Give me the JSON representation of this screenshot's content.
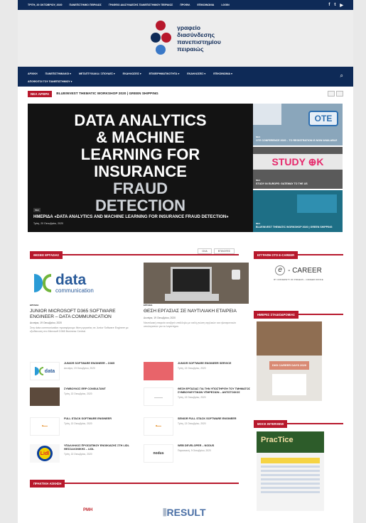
{
  "topbar": {
    "date": "ΤΡΙΤΗ, 20 ΟΚΤΩΒΡΙΟΥ, 2020",
    "links": [
      "ΠΑΝΕΠΙΣΤΗΜΙΟ ΠΕΙΡΑΙΩΣ",
      "ΓΡΑΦΕΙΟ ΔΙΑΣΥΝΔΕΣΗΣ ΠΑΝΕΠΙΣΤΗΜΙΟΥ ΠΕΙΡΑΙΩΣ",
      "ΠΡΟΦΙΛ",
      "ΕΠΙΚΟΙΝΩΝΙΑ",
      "LOGIN"
    ],
    "social": [
      "f",
      "t",
      "▶"
    ]
  },
  "logo": {
    "line1": "γραφείο",
    "line2": "διασύνδεσης",
    "line3": "πανεπιστημίου",
    "line4": "πειραιώς"
  },
  "nav": {
    "row1": [
      "ΑΡΧΙΚΗ",
      "ΠΑΝΕΠΙΣΤΗΜΙΑΚΟΙ ▾",
      "ΜΕΤΑΠΤΥΧΙΑΚΑ / ΣΠΟΥΔΕΣ ▾",
      "ΕΚΔΗΛΩΣΕΙΣ ▾",
      "ΕΠΙΧΕΙΡΗΜΑΤΙΚΟΤΗΤΑ ▾",
      "ΕΚΔΗΛΩΣΕΙΣ ▾",
      "ΕΠΙΚΟΙΝΩΝΙΑ ▾"
    ],
    "row2": [
      "ΑΠΟΦΟΙΤΟΙ ΤΟΥ ΠΑΝΕΠΙΣΤΗΜΙΟΥ ▾"
    ]
  },
  "ticker": {
    "badge": "ΝΕΑ ΑΡΘΡΑ",
    "text": "BLUEINVEST THEMATIC WORKSHOP 2020 | GREEN SHIPPING"
  },
  "hero": {
    "line1": "DATA ANALYTICS",
    "line2": "& MACHINE",
    "line3": "LEARNING FOR",
    "line4": "INSURANCE",
    "line5": "FRAUD",
    "line6": "DETECTION",
    "tag": "ΝΕΑ",
    "caption": "ΗΜΕΡΙΔΑ «DATA ANALYTICS AND MACHINE LEARNING FOR INSURANCE FRAUD DETECTION»",
    "meta": "Τρίτη, 20 Οκτωβρίου, 2020"
  },
  "tiles": [
    {
      "tag": "ΝΕΑ",
      "title": "OTE CONFERENCE 2020 – ΤΟ REGISTRATION IS NOW AVAILABLE",
      "logo": "OTE"
    },
    {
      "tag": "ΝΕΑ",
      "title": "STUDY IN EUROPE: GATEWAY TO THE US",
      "logo": "STUDY ⊕K"
    },
    {
      "tag": "ΝΕΑ",
      "title": "BLUEINVEST THEMATIC WORKSHOP 2020 | GREEN SHIPPING"
    }
  ],
  "jobs": {
    "heading": "ΘΕΣΕΙΣ ΕΡΓΑΣΙΑΣ",
    "tabs": [
      "ΟΛΑ",
      "ΕΠΙΛΟΓΕΣ"
    ],
    "featured": [
      {
        "tag": "ΕΡΓΑΣΙΑ",
        "title": "JUNIOR MICROSOFT D365 SOFTWARE ENGINEER – DATA COMMUNICATION",
        "meta": "Δευτέρα, 19 Οκτωβρίου, 2020",
        "excerpt": "Στην data communication προσφέρουμε θέση εργασίας σε Junior Software Engineer με εξειδίκευση στο Microsoft D365 Business Central."
      },
      {
        "tag": "ΕΡΓΑΣΙΑ",
        "title": "ΘΕΣΗ ΕΡΓΑΣΙΑΣ ΣΕ ΝΑΥΤΙΛΙΑΚΗ ΕΤΑΙΡΕΙΑ",
        "meta": "Δευτέρα, 19 Οκτωβρίου, 2020",
        "excerpt": "Ναυτιλιακή εταιρεία αναζητά υπάλληλο με καλή γνώση αγγλικών και ηλεκτρονικών υπολογιστών για το λογιστήριο."
      }
    ],
    "list_left": [
      {
        "title": "JUNIOR SOFTWARE ENGINEER – D365",
        "meta": "Δευτέρα, 19 Οκτωβρίου, 2020"
      },
      {
        "title": "ΣΥΜΒΟΥΛΟΣ ERP CONSULTANT",
        "meta": "Τρίτη, 13 Οκτωβρίου, 2020"
      },
      {
        "title": "FULL STACK SOFTWARE ENGINEER",
        "meta": "Τρίτη, 13 Οκτωβρίου, 2020"
      },
      {
        "title": "ΥΠΑΛΛΗΛΟΣ ΠΡΟΣΩΠΙΚΟΥ ΕΝΟΙΚΙΑΣΗΣ ΣΤΗ LIDL ΘΕΣΣΑΛΟΝΙΚΗΣ – LIDL",
        "meta": "Τρίτη, 13 Οκτωβρίου, 2020"
      }
    ],
    "list_right": [
      {
        "title": "JUNIOR SOFTWARE ENGINEER SERVICE",
        "meta": "Τρίτη, 13 Οκτωβρίου, 2020"
      },
      {
        "title": "ΘΕΣΗ ΕΡΓΑΣΙΑΣ ΓΙΑ ΤΗΝ ΥΠΟΣΤΗΡΙΞΗ ΤΟΥ ΤΜΗΜΑΤΟΣ ΣΥΜΒΟΥΛΕΥΤΙΚΩΝ ΥΠΗΡΕΣΙΩΝ – ΑΝΤΙΣΤΟΙΧΟΣ",
        "meta": "Τρίτη, 13 Οκτωβρίου, 2020"
      },
      {
        "title": "SENIOR FULL STACK SOFTWARE ENGINEER",
        "meta": "Τρίτη, 13 Οκτωβρίου, 2020"
      },
      {
        "title": "WEB DEVELOPER – NODUS",
        "meta": "Παρασκευή, 9 Οκτωβρίου, 2020"
      }
    ]
  },
  "practice": {
    "heading": "ΠΡΑΚΤΙΚΗ ΑΣΚΗΣΗ",
    "logo1": "ΡΜΗ",
    "logo2": "RESULT",
    "logo2_sub": "Management Consultants"
  },
  "sidebar": {
    "ecareer_heading": "ΕΓΓΡΑΦΗ ΣΤΟ E-CAREER",
    "ecareer_logo": "- CAREER",
    "ecareer_sub": "BY UNIVERSITY OF PIRAEUS – CAREER OFFICE",
    "days_heading": "ΗΜΕΡΕΣ ΣΤΑΔΙΟΔΡΟΜΙΑΣ",
    "days_banner": "DIGI CAREER DAYS 2020",
    "mock_heading": "MOCK INTERVIEW",
    "mock_logo": "PracTice"
  },
  "colors": {
    "navy": "#0e2a57",
    "accent": "#b7182c"
  }
}
